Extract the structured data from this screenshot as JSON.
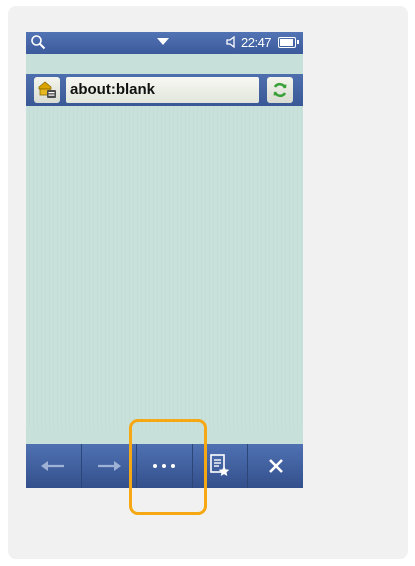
{
  "status_bar": {
    "time": "22:47",
    "battery_level": 0.8,
    "icons": [
      "search-icon",
      "dropdown-arrow-icon",
      "volume-icon",
      "battery-icon"
    ]
  },
  "address_bar": {
    "url": "about:blank",
    "icons": [
      "home-folder-icon",
      "refresh-icon"
    ]
  },
  "toolbar": {
    "items": [
      "back-arrow-icon",
      "forward-arrow-icon",
      "more-options-icon",
      "bookmarks-icon",
      "close-icon"
    ]
  },
  "colors": {
    "bar_blue": "#4565a6",
    "page_background": "#c8e0da",
    "highlight": "#f5a814",
    "refresh_green": "#3aa13a"
  }
}
